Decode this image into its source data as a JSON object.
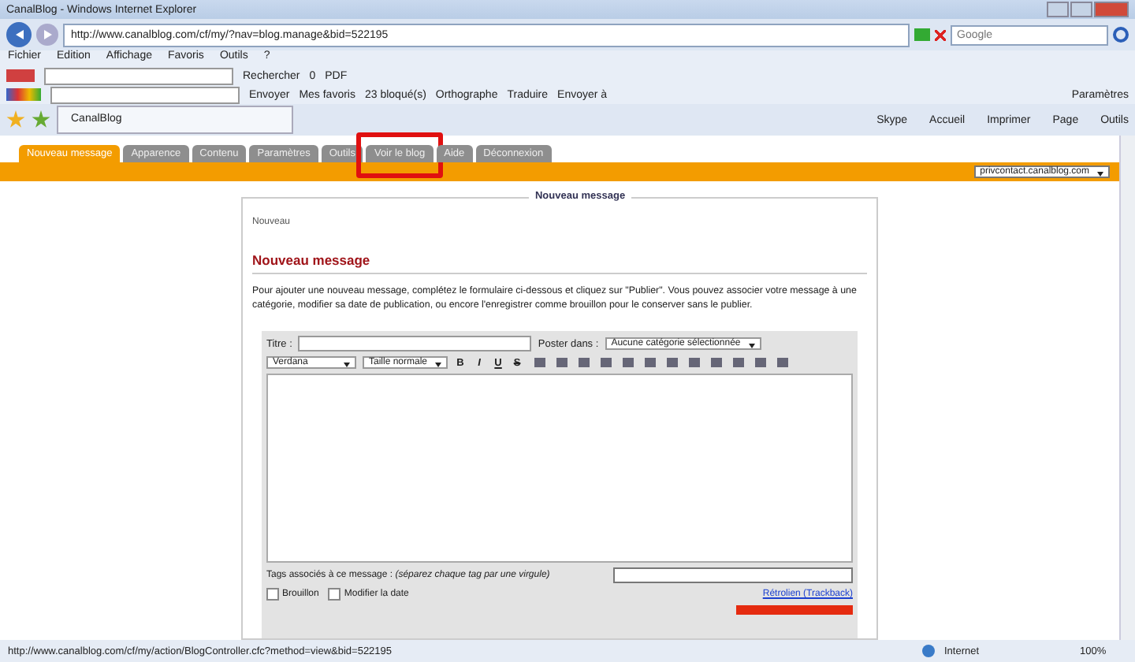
{
  "window": {
    "title": "CanalBlog - Windows Internet Explorer"
  },
  "address_bar": {
    "url": "http://www.canalblog.com/cf/my/?nav=blog.manage&bid=522195"
  },
  "search": {
    "placeholder": "Google"
  },
  "menu": [
    "Fichier",
    "Edition",
    "Affichage",
    "Favoris",
    "Outils",
    "?"
  ],
  "pdf_toolbar": {
    "items": [
      "Rechercher",
      "0",
      "PDF"
    ]
  },
  "google_toolbar": {
    "send": "Envoyer",
    "items": [
      "Mes favoris",
      "23 bloqué(s)",
      "Orthographe",
      "Traduire",
      "Envoyer à"
    ],
    "settings": "Paramètres"
  },
  "browser_tab": {
    "title": "CanalBlog"
  },
  "commands": [
    "Skype",
    "Accueil",
    "Imprimer",
    "Page",
    "Outils"
  ],
  "site_tabs": [
    {
      "label": "Nouveau message",
      "selected": true,
      "highlighted": false
    },
    {
      "label": "Apparence",
      "selected": false,
      "highlighted": false
    },
    {
      "label": "Contenu",
      "selected": false,
      "highlighted": false
    },
    {
      "label": "Paramètres",
      "selected": false,
      "highlighted": false
    },
    {
      "label": "Outils",
      "selected": false,
      "highlighted": false
    },
    {
      "label": "Voir le blog",
      "selected": false,
      "highlighted": true
    },
    {
      "label": "Aide",
      "selected": false,
      "highlighted": false
    },
    {
      "label": "Déconnexion",
      "selected": false,
      "highlighted": false
    }
  ],
  "blog_select": "privcontact.canalblog.com",
  "panel": {
    "legend": "Nouveau message",
    "breadcrumb": "Nouveau",
    "heading": "Nouveau message",
    "intro": "Pour ajouter une nouveau message, complétez le formulaire ci-dessous et cliquez sur \"Publier\". Vous pouvez associer votre message à une catégorie, modifier sa date de publication, ou encore l'enregistrer comme brouillon pour le conserver sans le publier."
  },
  "form": {
    "title_label": "Titre :",
    "category_label": "Poster dans :",
    "category": "Aucune catégorie sélectionnée",
    "font": "Verdana",
    "size": "Taille normale",
    "format_buttons": [
      "B",
      "I",
      "U",
      "S"
    ],
    "tags": "Tags associés à ce message : *(séparez chaque tag par une virgule)*",
    "options": [
      {
        "label": "Brouillon",
        "checked": false
      },
      {
        "label": "Modifier la date",
        "checked": false
      }
    ],
    "trackback": "Rétrolien (Trackback)"
  },
  "status_bar": {
    "url": "http://www.canalblog.com/cf/my/action/BlogController.cfc?method=view&bid=522195",
    "zone": "Internet",
    "zoom": "100%"
  }
}
